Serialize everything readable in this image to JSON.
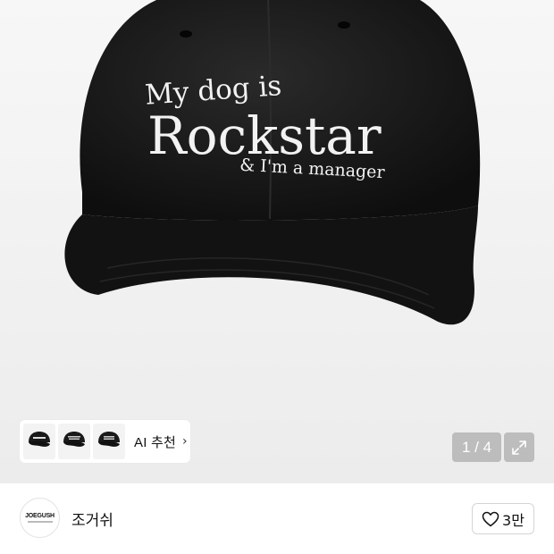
{
  "product_image": {
    "embroidery_line1": "My dog is",
    "embroidery_line2": "Rockstar",
    "embroidery_line3": "& I'm a manager",
    "cap_color": "#151515",
    "thread_color": "#f2f2f2"
  },
  "recommend": {
    "label": "AI 추천",
    "chevron": "›",
    "thumbnails": [
      "thumbnail-cap-1",
      "thumbnail-cap-2",
      "thumbnail-cap-3"
    ]
  },
  "gallery": {
    "counter": "1 / 4",
    "expand_icon": "expand-icon"
  },
  "shop": {
    "logo_text": "JOEGUSH",
    "name": "조거쉬",
    "like_count": "3만",
    "like_icon": "heart-icon"
  }
}
